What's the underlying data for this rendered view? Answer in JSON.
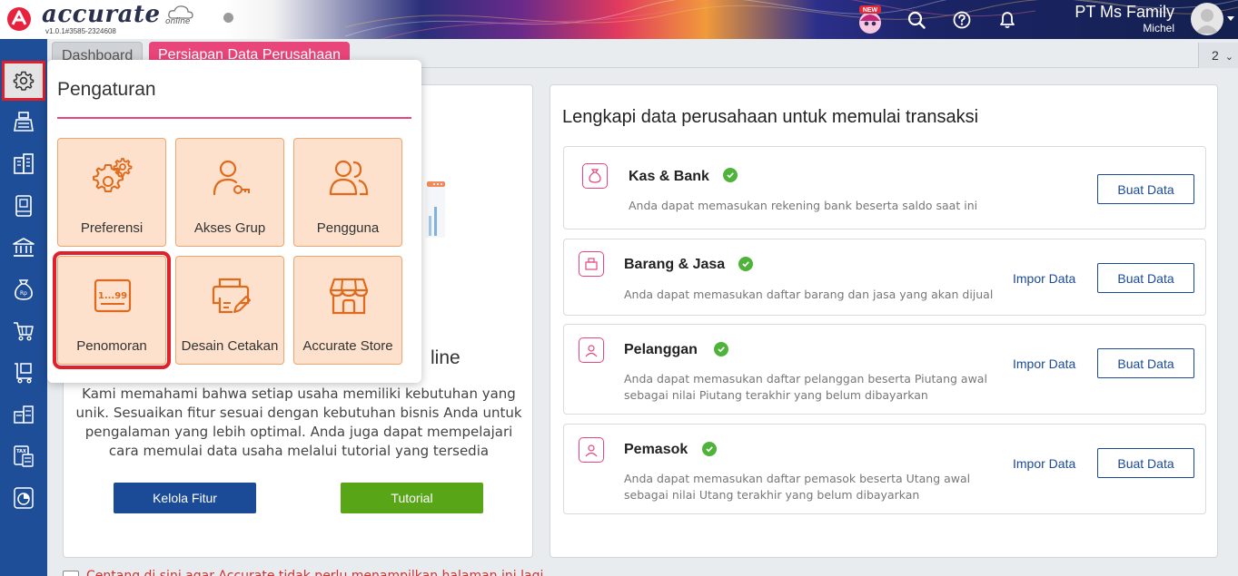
{
  "app": {
    "logo_text": "accurate",
    "logo_sub": "online",
    "version": "v1.0.1#3585-2324608",
    "new_badge": "NEW"
  },
  "header": {
    "company_name": "PT Ms Family",
    "user_name": "Michel"
  },
  "tabs": [
    {
      "label": "Dashboard"
    },
    {
      "label": "Persiapan Data Perusahaan"
    }
  ],
  "tab_count": "2",
  "tab_count_chevron": "⌄",
  "sidebar": {
    "items": [
      {
        "icon": "gear-icon",
        "active": true
      },
      {
        "icon": "cash-register-icon"
      },
      {
        "icon": "building-icon"
      },
      {
        "icon": "ledger-book-icon"
      },
      {
        "icon": "bank-icon"
      },
      {
        "icon": "money-bag-icon"
      },
      {
        "icon": "cart-icon"
      },
      {
        "icon": "box-cart-icon"
      },
      {
        "icon": "warehouse-icon"
      },
      {
        "icon": "tax-doc-icon"
      },
      {
        "icon": "report-chart-icon"
      }
    ]
  },
  "popup": {
    "title": "Pengaturan",
    "tiles": [
      {
        "label": "Preferensi",
        "icon": "gears-icon"
      },
      {
        "label": "Akses Grup",
        "icon": "user-key-icon"
      },
      {
        "label": "Pengguna",
        "icon": "users-icon"
      },
      {
        "label": "Penomoran",
        "icon": "numbering-icon",
        "selected": true,
        "icon_text": "1...99"
      },
      {
        "label": "Desain Cetakan",
        "icon": "printer-design-icon"
      },
      {
        "label": "Accurate Store",
        "icon": "store-icon"
      }
    ]
  },
  "left": {
    "heading_tail": "line",
    "description": "Kami memahami bahwa setiap usaha memiliki kebutuhan yang unik. Sesuaikan fitur sesuai dengan kebutuhan bisnis Anda untuk pengalaman yang lebih optimal. Anda juga dapat mempelajari cara memulai data usaha melalui tutorial yang tersedia",
    "kelola_label": "Kelola Fitur",
    "tutorial_label": "Tutorial"
  },
  "right": {
    "title": "Lengkapi data perusahaan untuk memulai transaksi",
    "cards": [
      {
        "title": "Kas & Bank",
        "desc": [
          "Anda dapat memasukan rekening bank beserta saldo saat ini"
        ],
        "impor": "",
        "buat": "Buat Data"
      },
      {
        "title": "Barang & Jasa",
        "desc": [
          "Anda dapat memasukan daftar barang dan jasa yang akan dijual"
        ],
        "impor": "Impor Data",
        "buat": "Buat Data"
      },
      {
        "title": "Pelanggan",
        "desc": [
          "Anda dapat memasukan daftar pelanggan beserta Piutang awal",
          "sebagai nilai Piutang terakhir yang belum dibayarkan"
        ],
        "impor": "Impor Data",
        "buat": "Buat Data"
      },
      {
        "title": "Pemasok",
        "desc": [
          "Anda dapat memasukan daftar pemasok beserta Utang awal",
          "sebagai nilai Utang terakhir yang belum dibayarkan"
        ],
        "impor": "Impor Data",
        "buat": "Buat Data"
      }
    ]
  },
  "footer": {
    "notice": "Centang di sini agar Accurate tidak perlu menampilkan halaman ini lagi"
  },
  "colors": {
    "accent_pink": "#e8457a",
    "primary_blue": "#1b4a97",
    "sidebar_blue": "#1f4e98",
    "success_green": "#4fb33a",
    "tutorial_green": "#58a617",
    "tile_bg": "#fde1cc",
    "highlight_red": "#e0202a"
  }
}
